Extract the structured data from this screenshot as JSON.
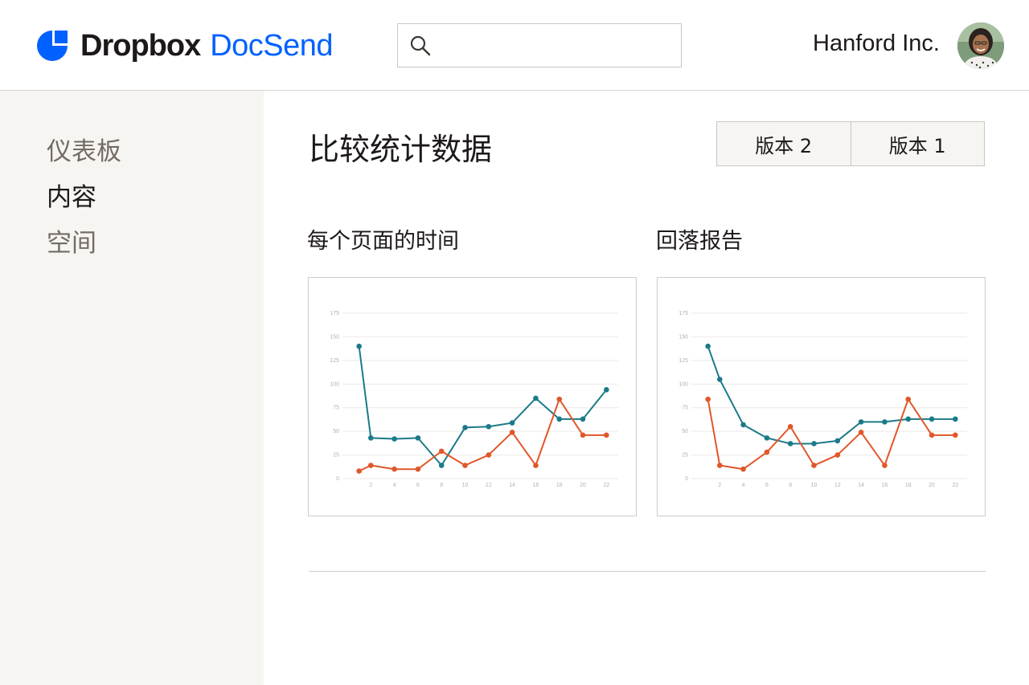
{
  "header": {
    "brand": "Dropbox",
    "product": "DocSend",
    "search": {
      "value": "",
      "placeholder": ""
    },
    "company": "Hanford Inc."
  },
  "sidebar": {
    "items": [
      {
        "label": "仪表板",
        "active": false
      },
      {
        "label": "内容",
        "active": true
      },
      {
        "label": "空间",
        "active": false
      }
    ]
  },
  "main": {
    "title": "比较统计数据",
    "version_tabs": [
      "版本 2",
      "版本 1"
    ]
  },
  "colors": {
    "accent_blue": "#0061fe",
    "series_teal": "#1b7a89",
    "series_orange": "#e0572a"
  },
  "chart_data": [
    {
      "type": "line",
      "title": "每个页面的时间",
      "x": [
        1,
        2,
        4,
        6,
        8,
        10,
        12,
        14,
        16,
        18,
        20,
        22
      ],
      "xticks": [
        "2",
        "4",
        "6",
        "8",
        "10",
        "12",
        "14",
        "16",
        "18",
        "20",
        "22"
      ],
      "yticks": [
        "0",
        "25",
        "50",
        "75",
        "100",
        "125",
        "150",
        "175"
      ],
      "ylim": [
        0,
        175
      ],
      "xlim": [
        0,
        23
      ],
      "grid": true,
      "series": [
        {
          "color": "#1b7a89",
          "values": [
            140,
            43,
            42,
            43,
            14,
            54,
            55,
            59,
            85,
            63,
            63,
            94
          ]
        },
        {
          "color": "#e0572a",
          "values": [
            8,
            14,
            10,
            10,
            29,
            14,
            25,
            49,
            14,
            84,
            46,
            46
          ]
        }
      ]
    },
    {
      "type": "line",
      "title": "回落报告",
      "x": [
        1,
        2,
        4,
        6,
        8,
        10,
        12,
        14,
        16,
        18,
        20,
        22
      ],
      "xticks": [
        "2",
        "4",
        "6",
        "8",
        "10",
        "12",
        "14",
        "16",
        "18",
        "20",
        "22"
      ],
      "yticks": [
        "0",
        "25",
        "50",
        "75",
        "100",
        "125",
        "150",
        "175"
      ],
      "ylim": [
        0,
        175
      ],
      "xlim": [
        0,
        23
      ],
      "grid": true,
      "series": [
        {
          "color": "#1b7a89",
          "values": [
            140,
            105,
            57,
            43,
            37,
            37,
            40,
            60,
            60,
            63,
            63,
            63
          ]
        },
        {
          "color": "#e0572a",
          "values": [
            84,
            14,
            10,
            28,
            55,
            14,
            25,
            49,
            14,
            84,
            46,
            46
          ]
        }
      ]
    }
  ]
}
